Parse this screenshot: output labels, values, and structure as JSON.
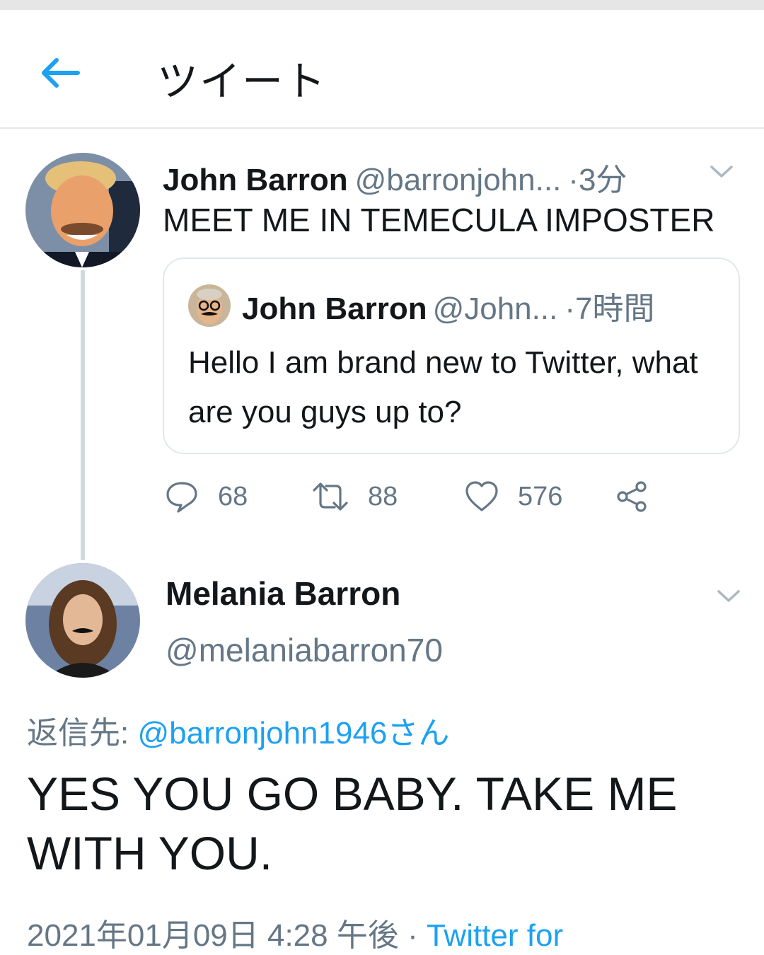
{
  "header": {
    "back_icon": "arrow-left-icon",
    "title": "ツイート",
    "accent_color": "#1da1f2"
  },
  "tweet": {
    "author_name": "John Barron",
    "author_handle": "@barronjohn...",
    "dot": "·",
    "time": "3分",
    "text": "MEET ME IN TEMECULA IMPOSTER",
    "quote": {
      "author_name": "John Barron",
      "author_handle": "@John...",
      "dot": "·",
      "time": "7時間",
      "text": "Hello I am brand new to Twitter, what are you guys up to?"
    },
    "actions": {
      "reply_count": "68",
      "retweet_count": "88",
      "like_count": "576"
    }
  },
  "reply": {
    "author_name": "Melania Barron",
    "author_handle": "@melaniabarron70",
    "replying_prefix": "返信先:",
    "replying_to": "@barronjohn1946さん",
    "text": "YES YOU GO BABY. TAKE ME WITH YOU.",
    "timestamp": "2021年01月09日 4:28 午後",
    "dot": "·",
    "source": "Twitter for"
  }
}
